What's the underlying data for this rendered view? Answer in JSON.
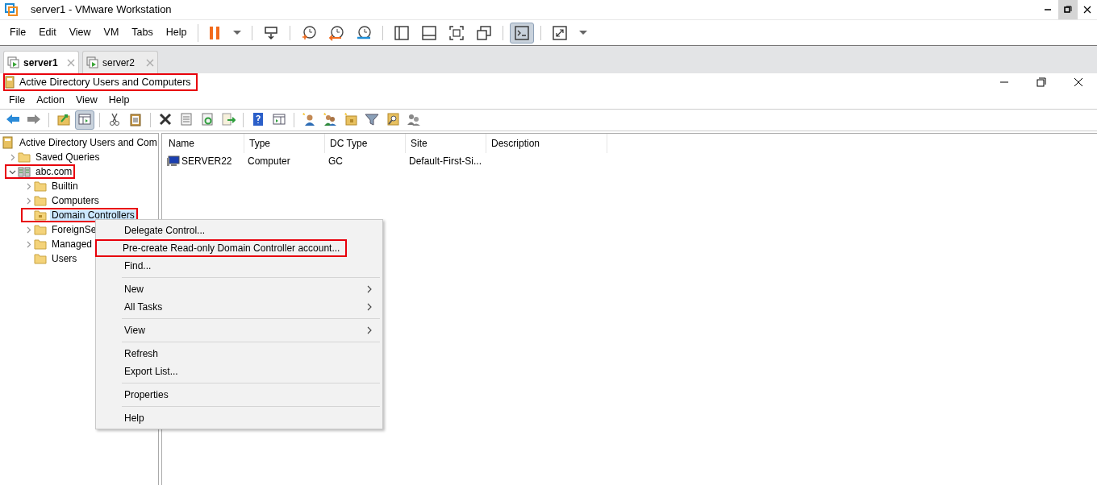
{
  "window": {
    "title": "server1 - VMware Workstation"
  },
  "menu": [
    "File",
    "Edit",
    "View",
    "VM",
    "Tabs",
    "Help"
  ],
  "toolbar": [
    {
      "kind": "pause",
      "pressed": false
    },
    {
      "kind": "dropdown",
      "pressed": false
    },
    {
      "kind": "separator"
    },
    {
      "kind": "send-keys",
      "pressed": false
    },
    {
      "kind": "separator"
    },
    {
      "kind": "snapshot-take",
      "pressed": false
    },
    {
      "kind": "snapshot-revert",
      "pressed": false
    },
    {
      "kind": "snapshot-manager",
      "pressed": false
    },
    {
      "kind": "separator"
    },
    {
      "kind": "sidebar",
      "pressed": false
    },
    {
      "kind": "thumbnail-bar",
      "pressed": false
    },
    {
      "kind": "fullscreen",
      "pressed": false
    },
    {
      "kind": "unity",
      "pressed": false
    },
    {
      "kind": "separator"
    },
    {
      "kind": "console",
      "pressed": true
    },
    {
      "kind": "separator"
    },
    {
      "kind": "stretch",
      "pressed": false
    },
    {
      "kind": "dropdown",
      "pressed": false
    }
  ],
  "tabs": [
    {
      "label": "server1",
      "selected": true
    },
    {
      "label": "server2",
      "selected": false
    }
  ],
  "app_window": {
    "title": "Active Directory Users and Computers",
    "title_highlighted": true,
    "menu": [
      "File",
      "Action",
      "View",
      "Help"
    ],
    "toolbar": [
      {
        "kind": "back",
        "pressed": false
      },
      {
        "kind": "forward",
        "pressed": false
      },
      {
        "kind": "separator"
      },
      {
        "kind": "up-folder",
        "pressed": false
      },
      {
        "kind": "console-tree",
        "pressed": true
      },
      {
        "kind": "separator"
      },
      {
        "kind": "cut",
        "pressed": false
      },
      {
        "kind": "paste",
        "pressed": false
      },
      {
        "kind": "separator"
      },
      {
        "kind": "delete",
        "pressed": false
      },
      {
        "kind": "properties",
        "pressed": false
      },
      {
        "kind": "refresh",
        "pressed": false
      },
      {
        "kind": "export",
        "pressed": false
      },
      {
        "kind": "separator"
      },
      {
        "kind": "help",
        "pressed": false
      },
      {
        "kind": "action-pane",
        "pressed": false
      },
      {
        "kind": "separator"
      },
      {
        "kind": "new-user",
        "pressed": false
      },
      {
        "kind": "new-group",
        "pressed": false
      },
      {
        "kind": "new-ou",
        "pressed": false
      },
      {
        "kind": "filter",
        "pressed": false
      },
      {
        "kind": "find",
        "pressed": false
      },
      {
        "kind": "add-to-group",
        "pressed": false
      }
    ],
    "tree": [
      {
        "label": "Active Directory Users and Com",
        "kind": "root",
        "expandable": false,
        "selected": false,
        "highlighted": false,
        "children": [
          {
            "label": "Saved Queries",
            "kind": "folder",
            "expandable": true,
            "expanded": false,
            "selected": false,
            "highlighted": false
          },
          {
            "label": "abc.com",
            "kind": "domain",
            "expandable": true,
            "expanded": true,
            "selected": false,
            "highlighted": true,
            "children": [
              {
                "label": "Builtin",
                "kind": "folder",
                "expandable": true,
                "expanded": false,
                "selected": false,
                "highlighted": false
              },
              {
                "label": "Computers",
                "kind": "folder",
                "expandable": true,
                "expanded": false,
                "selected": false,
                "highlighted": false
              },
              {
                "label": "Domain Controllers",
                "kind": "ou",
                "expandable": false,
                "selected": true,
                "highlighted": true
              },
              {
                "label": "ForeignSe",
                "kind": "folder",
                "expandable": true,
                "expanded": false,
                "selected": false,
                "highlighted": false
              },
              {
                "label": "Managed",
                "kind": "folder",
                "expandable": true,
                "expanded": false,
                "selected": false,
                "highlighted": false
              },
              {
                "label": "Users",
                "kind": "folder",
                "expandable": false,
                "selected": false,
                "highlighted": false
              }
            ]
          }
        ]
      }
    ],
    "table": {
      "columns": [
        "Name",
        "Type",
        "DC Type",
        "Site",
        "Description"
      ],
      "rows": [
        {
          "cells": [
            "SERVER22",
            "Computer",
            "GC",
            "Default-First-Si..."
          ]
        }
      ]
    },
    "context_menu": [
      {
        "kind": "item",
        "label": "Delegate Control...",
        "submenu": false,
        "highlighted": false
      },
      {
        "kind": "item",
        "label": "Pre-create Read-only Domain Controller account...",
        "submenu": false,
        "highlighted": true
      },
      {
        "kind": "item",
        "label": "Find...",
        "submenu": false,
        "highlighted": false
      },
      {
        "kind": "separator"
      },
      {
        "kind": "item",
        "label": "New",
        "submenu": true,
        "highlighted": false
      },
      {
        "kind": "item",
        "label": "All Tasks",
        "submenu": true,
        "highlighted": false
      },
      {
        "kind": "separator"
      },
      {
        "kind": "item",
        "label": "View",
        "submenu": true,
        "highlighted": false
      },
      {
        "kind": "separator"
      },
      {
        "kind": "item",
        "label": "Refresh",
        "submenu": false,
        "highlighted": false
      },
      {
        "kind": "item",
        "label": "Export List...",
        "submenu": false,
        "highlighted": false
      },
      {
        "kind": "separator"
      },
      {
        "kind": "item",
        "label": "Properties",
        "submenu": false,
        "highlighted": false
      },
      {
        "kind": "separator"
      },
      {
        "kind": "item",
        "label": "Help",
        "submenu": false,
        "highlighted": false
      }
    ]
  }
}
